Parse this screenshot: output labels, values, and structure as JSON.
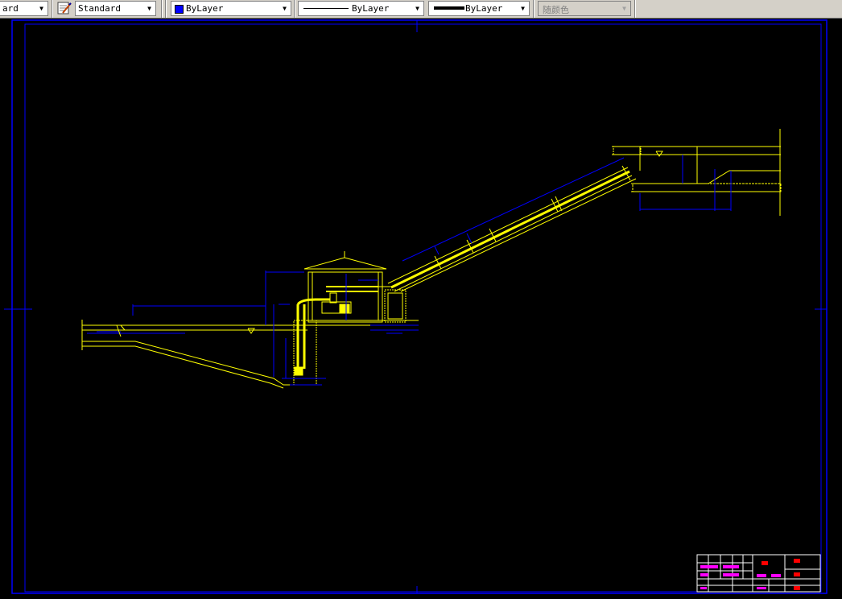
{
  "toolbar": {
    "text_style": "ard",
    "dim_style": "Standard",
    "layer_color": "ByLayer",
    "linetype": "ByLayer",
    "lineweight": "ByLayer",
    "plot_style": "随颜色"
  },
  "colors": {
    "drawing_line": "#ffff00",
    "dimension": "#0000ff",
    "border": "#0000ff",
    "background": "#000000",
    "title_block_text": "#ff00ff"
  },
  "icons": [
    "chevron-down-icon",
    "dimension-style-icon"
  ]
}
